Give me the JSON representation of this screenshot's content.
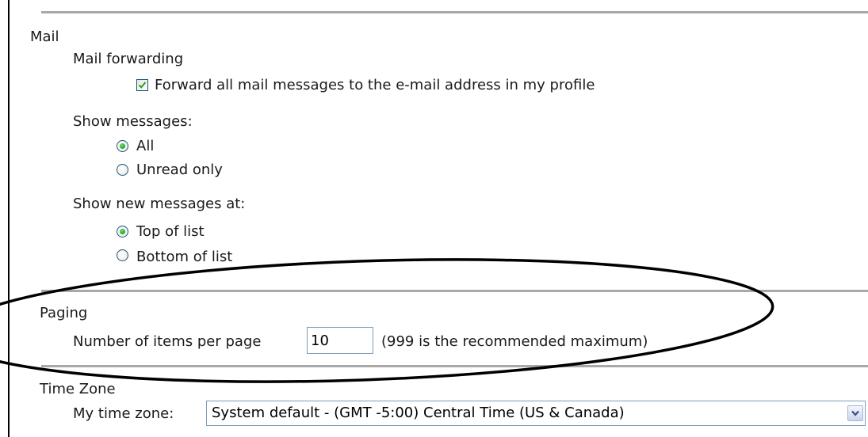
{
  "mail": {
    "heading": "Mail",
    "forwarding": {
      "label": "Mail forwarding",
      "checkbox_label": "Forward all mail messages to the e-mail address in my profile",
      "checked": true
    },
    "show_messages": {
      "label": "Show messages:",
      "options": [
        "All",
        "Unread only"
      ],
      "selected": "All"
    },
    "show_new_at": {
      "label": "Show new messages at:",
      "options": [
        "Top of list",
        "Bottom of list"
      ],
      "selected": "Top of list"
    }
  },
  "paging": {
    "heading": "Paging",
    "items_label": "Number of items per page",
    "items_value": "10",
    "hint": "(999 is the recommended maximum)"
  },
  "timezone": {
    "heading": "Time Zone",
    "label": "My time zone:",
    "selected": "System default - (GMT -5:00) Central Time (US & Canada)"
  },
  "colors": {
    "rule": "#a8a8a8",
    "radio_dot": "#21a121",
    "checkmark": "#21a121",
    "input_border": "#7f9db9",
    "annotation": "#000000"
  },
  "icons": {
    "checkbox": "checkmark-icon",
    "select_arrow": "chevron-down-icon"
  }
}
